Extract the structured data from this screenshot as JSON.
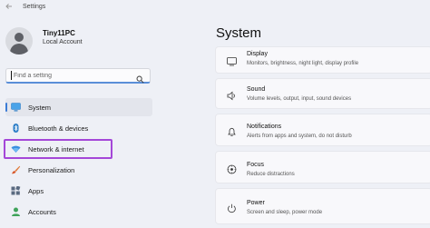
{
  "titlebar": {
    "title": "Settings"
  },
  "profile": {
    "name": "Tiny11PC",
    "account": "Local Account"
  },
  "search": {
    "placeholder": "Find a setting"
  },
  "sidebar": {
    "items": [
      {
        "label": "System",
        "icon": "monitor-icon"
      },
      {
        "label": "Bluetooth & devices",
        "icon": "bluetooth-icon"
      },
      {
        "label": "Network & internet",
        "icon": "wifi-icon"
      },
      {
        "label": "Personalization",
        "icon": "paintbrush-icon"
      },
      {
        "label": "Apps",
        "icon": "apps-icon"
      },
      {
        "label": "Accounts",
        "icon": "person-icon"
      }
    ]
  },
  "main": {
    "title": "System",
    "cards": [
      {
        "title": "Display",
        "subtitle": "Monitors, brightness, night light, display profile",
        "icon": "display-icon"
      },
      {
        "title": "Sound",
        "subtitle": "Volume levels, output, input, sound devices",
        "icon": "speaker-icon"
      },
      {
        "title": "Notifications",
        "subtitle": "Alerts from apps and system, do not disturb",
        "icon": "bell-icon"
      },
      {
        "title": "Focus",
        "subtitle": "Reduce distractions",
        "icon": "focus-icon"
      },
      {
        "title": "Power",
        "subtitle": "Screen and sleep, power mode",
        "icon": "power-icon"
      }
    ]
  },
  "colors": {
    "accent": "#3a7bd5",
    "highlight": "#a447d8"
  }
}
